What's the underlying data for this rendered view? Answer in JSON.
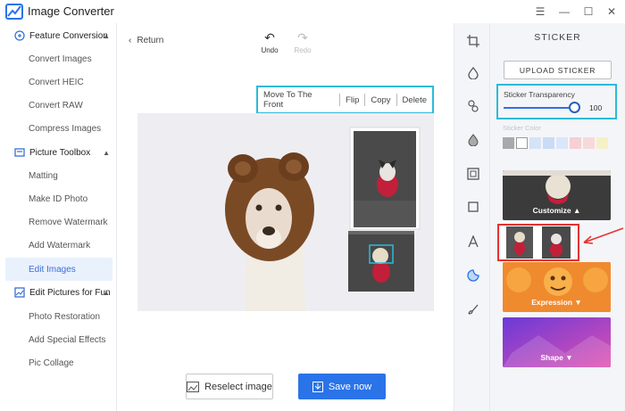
{
  "app": {
    "title": "Image Converter"
  },
  "window": {
    "minimize": "—",
    "maximize": "☐",
    "close": "✕",
    "menu": "☰"
  },
  "sidebar": {
    "sections": [
      {
        "label": "Feature Conversion",
        "items": [
          "Convert Images",
          "Convert HEIC",
          "Convert RAW",
          "Compress Images"
        ]
      },
      {
        "label": "Picture Toolbox",
        "items": [
          "Matting",
          "Make ID Photo",
          "Remove Watermark",
          "Add Watermark",
          "Edit Images"
        ]
      },
      {
        "label": "Edit Pictures for Fun",
        "items": [
          "Photo Restoration",
          "Add Special Effects",
          "Pic Collage"
        ]
      }
    ],
    "active_item": "Edit Images"
  },
  "main": {
    "return_label": "Return",
    "undo_label": "Undo",
    "redo_label": "Redo",
    "context_menu": [
      "Move To The Front",
      "Flip",
      "Copy",
      "Delete"
    ],
    "reselect_label": "Reselect image",
    "save_label": "Save now"
  },
  "panel": {
    "title": "STICKER",
    "upload_label": "UPLOAD STICKER",
    "transparency_label": "Sticker Transparency",
    "transparency_value": "100",
    "transparency_fraction": 1.0,
    "sticker_color_label": "Sticker Color",
    "swatches": [
      "#a9a9ad",
      "#ffffff",
      "#d6e3f7",
      "#c9dbf5",
      "#dbe6fb",
      "#f6d0d3",
      "#f7d9dc",
      "#f6f0c6"
    ],
    "categories": [
      {
        "label": "Customize ▲"
      },
      {
        "label": ""
      },
      {
        "label": "Expression ▼"
      },
      {
        "label": "Shape ▼"
      }
    ]
  },
  "colors": {
    "accent": "#2a73e8",
    "highlight": "#2bbbd9",
    "selection": "#e23333",
    "active_bg": "#e9f1fd"
  }
}
